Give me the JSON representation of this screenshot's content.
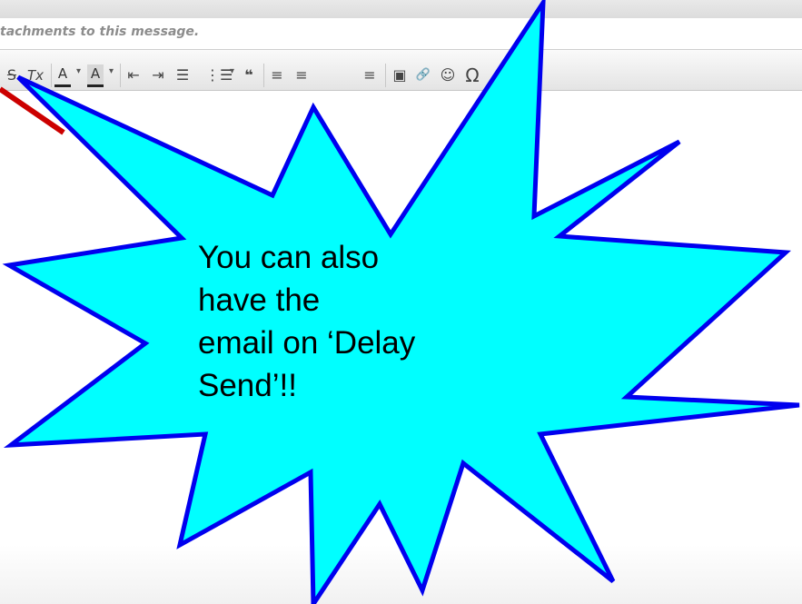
{
  "attachments": {
    "hint_text": "tachments to this message."
  },
  "toolbar": {
    "strikethrough_glyph": "S",
    "clear_format_glyph": "Tx",
    "text_color_glyph": "A",
    "bg_color_glyph": "A",
    "dropdown_caret": "▾",
    "indent_decrease_glyph": "⇤",
    "indent_increase_glyph": "⇥",
    "bullet_list_glyph": "☰",
    "numbered_list_glyph": "⋮☰",
    "blockquote_glyph": "❝",
    "align_left_glyph": "≡",
    "align_center_glyph": "≡",
    "align_justify_glyph": "≡",
    "image_glyph": "▣",
    "link_glyph": "🔗",
    "smiley_glyph": "☺",
    "omega_glyph": "Ω",
    "hr_glyph": "—",
    "table_glyph": "⊞"
  },
  "callout": {
    "line1": "You can also have the",
    "line2": "email on ‘Delay",
    "line3": "Send’!!",
    "fill_color": "#00ffff",
    "border_color": "#0000ee"
  },
  "annotation": {
    "arrow_color": "#cc0000"
  }
}
